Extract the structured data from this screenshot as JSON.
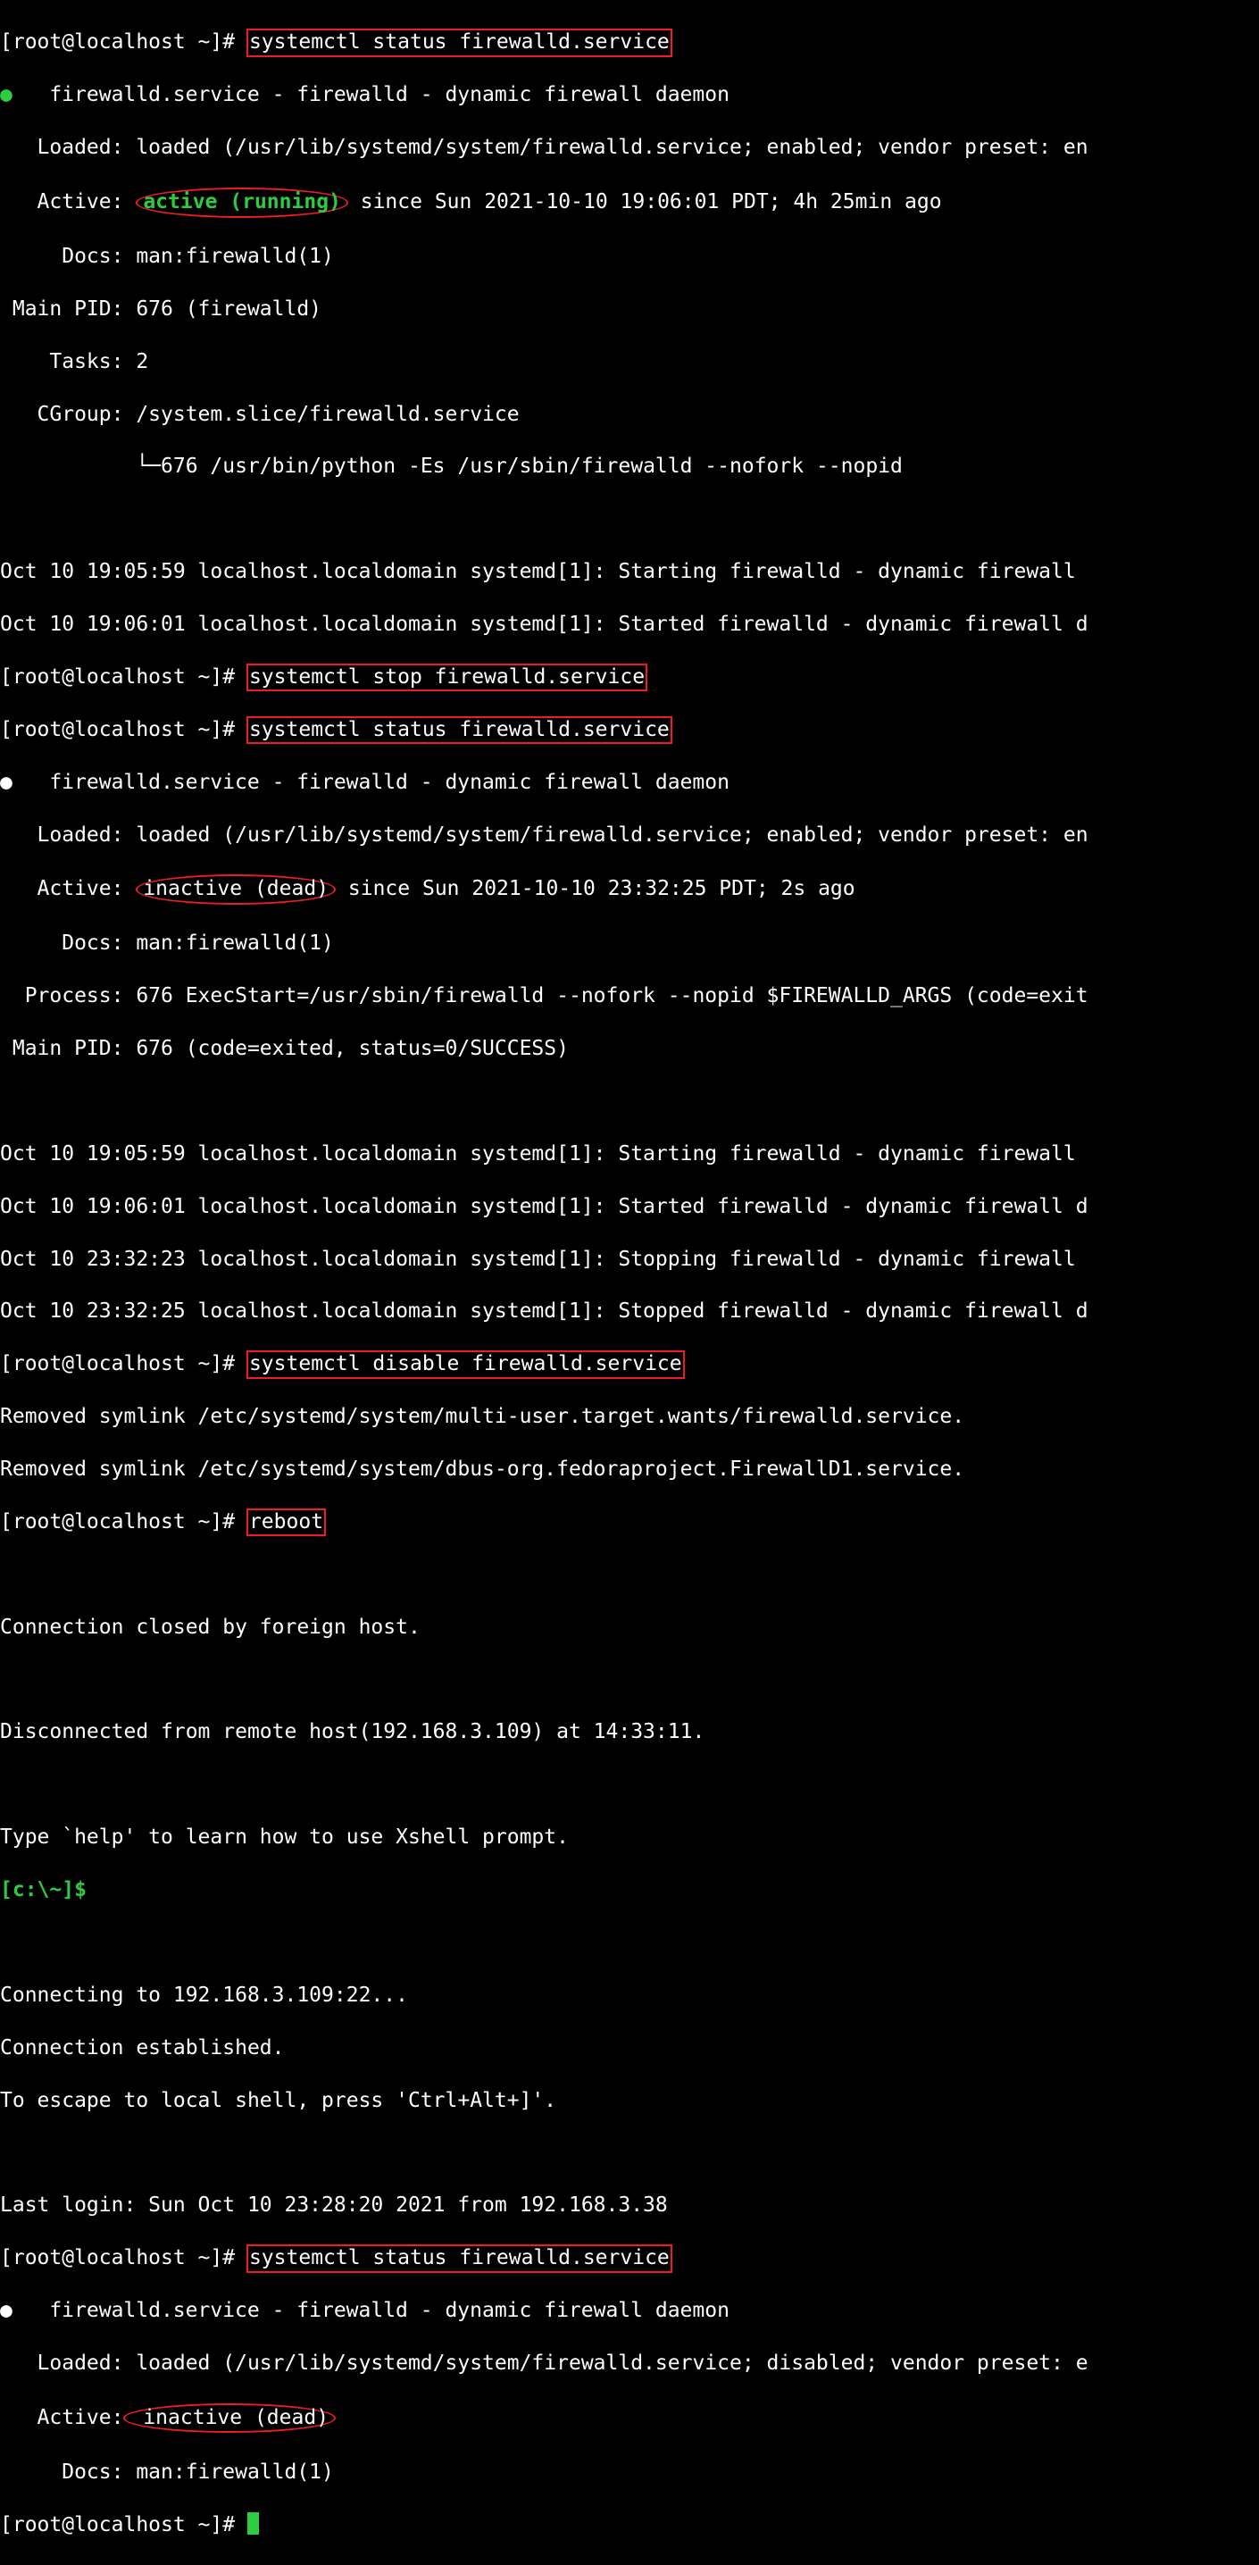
{
  "prompt": "[root@localhost ~]# ",
  "xshell_prompt": "[c:\\~]$ ",
  "tree_elbow": "└─",
  "cmd": {
    "status1": "systemctl status firewalld.service",
    "stop": "systemctl stop firewalld.service",
    "status2": "systemctl status firewalld.service",
    "disable": "systemctl disable firewalld.service",
    "reboot": "reboot",
    "status3": "systemctl status firewalld.service"
  },
  "status1": {
    "head_pre": "   firewalld.service - firewalld - dynamic firewall daemon",
    "loaded": "   Loaded: loaded (/usr/lib/systemd/system/firewalld.service; enabled; vendor preset: en",
    "active_pre": "   Active: ",
    "active_val": "active (running)",
    "active_post": " since Sun 2021-10-10 19:06:01 PDT; 4h 25min ago",
    "docs": "     Docs: man:firewalld(1)",
    "mainpid": " Main PID: 676 (firewalld)",
    "tasks": "    Tasks: 2",
    "cgroup": "   CGroup: /system.slice/firewalld.service",
    "cgroup_child": "676 /usr/bin/python -Es /usr/sbin/firewalld --nofork --nopid",
    "log1": "Oct 10 19:05:59 localhost.localdomain systemd[1]: Starting firewalld - dynamic firewall ",
    "log2": "Oct 10 19:06:01 localhost.localdomain systemd[1]: Started firewalld - dynamic firewall d"
  },
  "status2": {
    "head_pre": "   firewalld.service - firewalld - dynamic firewall daemon",
    "loaded": "   Loaded: loaded (/usr/lib/systemd/system/firewalld.service; enabled; vendor preset: en",
    "active_pre": "   Active: ",
    "active_val": "inactive (dead)",
    "active_post": " since Sun 2021-10-10 23:32:25 PDT; 2s ago",
    "docs": "     Docs: man:firewalld(1)",
    "process": "  Process: 676 ExecStart=/usr/sbin/firewalld --nofork --nopid $FIREWALLD_ARGS (code=exit",
    "mainpid": " Main PID: 676 (code=exited, status=0/SUCCESS)",
    "log1": "Oct 10 19:05:59 localhost.localdomain systemd[1]: Starting firewalld - dynamic firewall ",
    "log2": "Oct 10 19:06:01 localhost.localdomain systemd[1]: Started firewalld - dynamic firewall d",
    "log3": "Oct 10 23:32:23 localhost.localdomain systemd[1]: Stopping firewalld - dynamic firewall ",
    "log4": "Oct 10 23:32:25 localhost.localdomain systemd[1]: Stopped firewalld - dynamic firewall d"
  },
  "disable": {
    "rm1": "Removed symlink /etc/systemd/system/multi-user.target.wants/firewalld.service.",
    "rm2": "Removed symlink /etc/systemd/system/dbus-org.fedoraproject.FirewallD1.service."
  },
  "reconnect": {
    "closed": "Connection closed by foreign host.",
    "disc": "Disconnected from remote host(192.168.3.109) at 14:33:11.",
    "help": "Type `help' to learn how to use Xshell prompt.",
    "connecting": "Connecting to 192.168.3.109:22...",
    "established": "Connection established.",
    "escape": "To escape to local shell, press 'Ctrl+Alt+]'.",
    "lastlogin": "Last login: Sun Oct 10 23:28:20 2021 from 192.168.3.38"
  },
  "status3": {
    "head_pre": "   firewalld.service - firewalld - dynamic firewall daemon",
    "loaded": "   Loaded: loaded (/usr/lib/systemd/system/firewalld.service; disabled; vendor preset: e",
    "active_pre": "   Active:",
    "active_val": " inactive (dead)",
    "docs": "     Docs: man:firewalld(1)"
  }
}
